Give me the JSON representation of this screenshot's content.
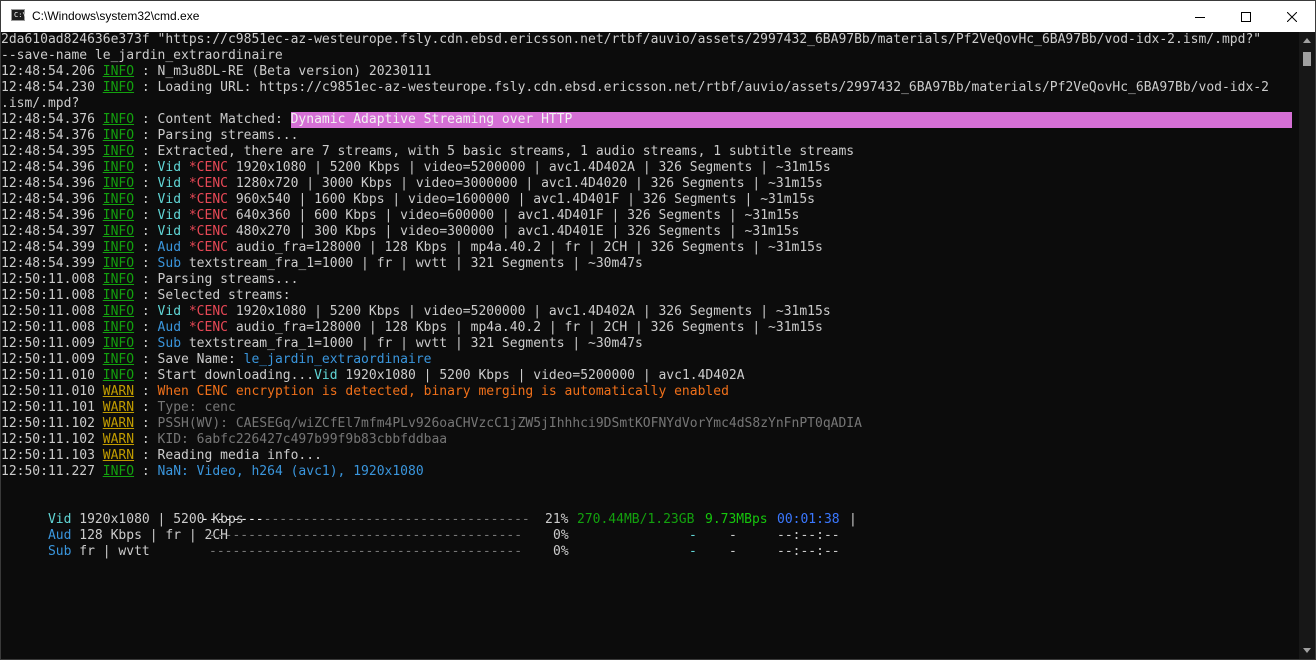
{
  "window": {
    "title": "C:\\Windows\\system32\\cmd.exe",
    "icon_text": "C:\\."
  },
  "console": {
    "line0": "2da610ad824636e373f \"https://c9851ec-az-westeurope.fsly.cdn.ebsd.ericsson.net/rtbf/auvio/assets/2997432_6BA97Bb/materials/Pf2VeQovHc_6BA97Bb/vod-idx-2.ism/.mpd?\"",
    "line1": "--save-name le_jardin_extraordinaire",
    "l2_time": "12:48:54.206",
    "l2_msg": "N_m3u8DL-RE (Beta version) 20230111",
    "l3_time": "12:48:54.230",
    "l3_msg": "Loading URL: https://c9851ec-az-westeurope.fsly.cdn.ebsd.ericsson.net/rtbf/auvio/assets/2997432_6BA97Bb/materials/Pf2VeQovHc_6BA97Bb/vod-idx-2",
    "line4": ".ism/.mpd?",
    "l5_time": "12:48:54.376",
    "l5_prefix": "Content Matched: ",
    "l5_highlight": "Dynamic Adaptive Streaming over HTTP",
    "l6_time": "12:48:54.376",
    "l6_msg": "Parsing streams...",
    "l7_time": "12:48:54.395",
    "l7_msg": "Extracted, there are 7 streams, with 5 basic streams, 1 audio streams, 1 subtitle streams",
    "l8_time": "12:48:54.396",
    "l8_msg": " 1920x1080 | 5200 Kbps | video=5200000 | avc1.4D402A | 326 Segments | ~31m15s",
    "l9_time": "12:48:54.396",
    "l9_msg": " 1280x720 | 3000 Kbps | video=3000000 | avc1.4D4020 | 326 Segments | ~31m15s",
    "l10_time": "12:48:54.396",
    "l10_msg": " 960x540 | 1600 Kbps | video=1600000 | avc1.4D401F | 326 Segments | ~31m15s",
    "l11_time": "12:48:54.396",
    "l11_msg": " 640x360 | 600 Kbps | video=600000 | avc1.4D401F | 326 Segments | ~31m15s",
    "l12_time": "12:48:54.397",
    "l12_msg": " 480x270 | 300 Kbps | video=300000 | avc1.4D401E | 326 Segments | ~31m15s",
    "l13_time": "12:48:54.399",
    "l13_msg": " audio_fra=128000 | 128 Kbps | mp4a.40.2 | fr | 2CH | 326 Segments | ~31m15s",
    "l14_time": "12:48:54.399",
    "l14_msg": " textstream_fra_1=1000 | fr | wvtt | 321 Segments | ~30m47s",
    "l15_time": "12:50:11.008",
    "l15_msg": "Parsing streams...",
    "l16_time": "12:50:11.008",
    "l16_msg": "Selected streams:",
    "l17_time": "12:50:11.008",
    "l17_msg": " 1920x1080 | 5200 Kbps | video=5200000 | avc1.4D402A | 326 Segments | ~31m15s",
    "l18_time": "12:50:11.008",
    "l18_msg": " audio_fra=128000 | 128 Kbps | mp4a.40.2 | fr | 2CH | 326 Segments | ~31m15s",
    "l19_time": "12:50:11.009",
    "l19_msg": " textstream_fra_1=1000 | fr | wvtt | 321 Segments | ~30m47s",
    "l20_time": "12:50:11.009",
    "l20_prefix": "Save Name: ",
    "l20_name": "le_jardin_extraordinaire",
    "l21_time": "12:50:11.010",
    "l21_prefix": "Start downloading...",
    "l21_msg": " 1920x1080 | 5200 Kbps | video=5200000 | avc1.4D402A",
    "l22_time": "12:50:11.010",
    "l22_msg": "When CENC encryption is detected, binary merging is automatically enabled",
    "l23_time": "12:50:11.101",
    "l23_msg": "Type: cenc",
    "l24_time": "12:50:11.102",
    "l24_msg": "PSSH(WV): CAESEGq/wiZCfEl7mfm4PLv926oaCHVzcC1jZW5jIhhhci9DSmtKOFNYdVorYmc4dS8zYnFnPT0qADIA",
    "l25_time": "12:50:11.102",
    "l25_msg": "KID: 6abfc226427c497b99f9b83cbbfddbaa",
    "l26_time": "12:50:11.103",
    "l26_msg": "Reading media info...",
    "l27_time": "12:50:11.227",
    "l27_msg": "NaN: Video, h264 (avc1), 1920x1080",
    "tag_info": "INFO",
    "tag_warn": "WARN",
    "sep": " : ",
    "kw_vid": "Vid",
    "kw_aud": "Aud",
    "kw_sub": "Sub",
    "kw_cenc": " *CENC"
  },
  "progress": {
    "vid_label": "Vid",
    "vid_info": " 1920x1080 | 5200 Kbps ",
    "vid_bar_done": "--------",
    "vid_bar_rest": "----------------------------------",
    "vid_pct": "21%",
    "vid_fraction": 0.21,
    "vid_size": "270.44MB/1.23GB",
    "vid_speed": "9.73MBps",
    "vid_eta": "00:01:38",
    "vid_end": "|",
    "aud_label": "Aud",
    "aud_info": " 128 Kbps | fr | 2CH   ",
    "aud_bar": "----------------------------------------",
    "aud_pct": "0%",
    "aud_fraction": 0,
    "aud_size": "-",
    "aud_speed": "-",
    "aud_eta": "--:--:--",
    "sub_label": "Sub",
    "sub_info": " fr | wvtt            ",
    "sub_bar": "----------------------------------------",
    "sub_pct": "0%",
    "sub_fraction": 0,
    "sub_size": "-",
    "sub_speed": "-",
    "sub_eta": "--:--:--"
  },
  "colors": {
    "background": "#0c0c0c",
    "info_tag": "#13a10e",
    "warn_tag": "#c19c00",
    "highlight": "#d670d6",
    "cenc": "#e74856"
  }
}
